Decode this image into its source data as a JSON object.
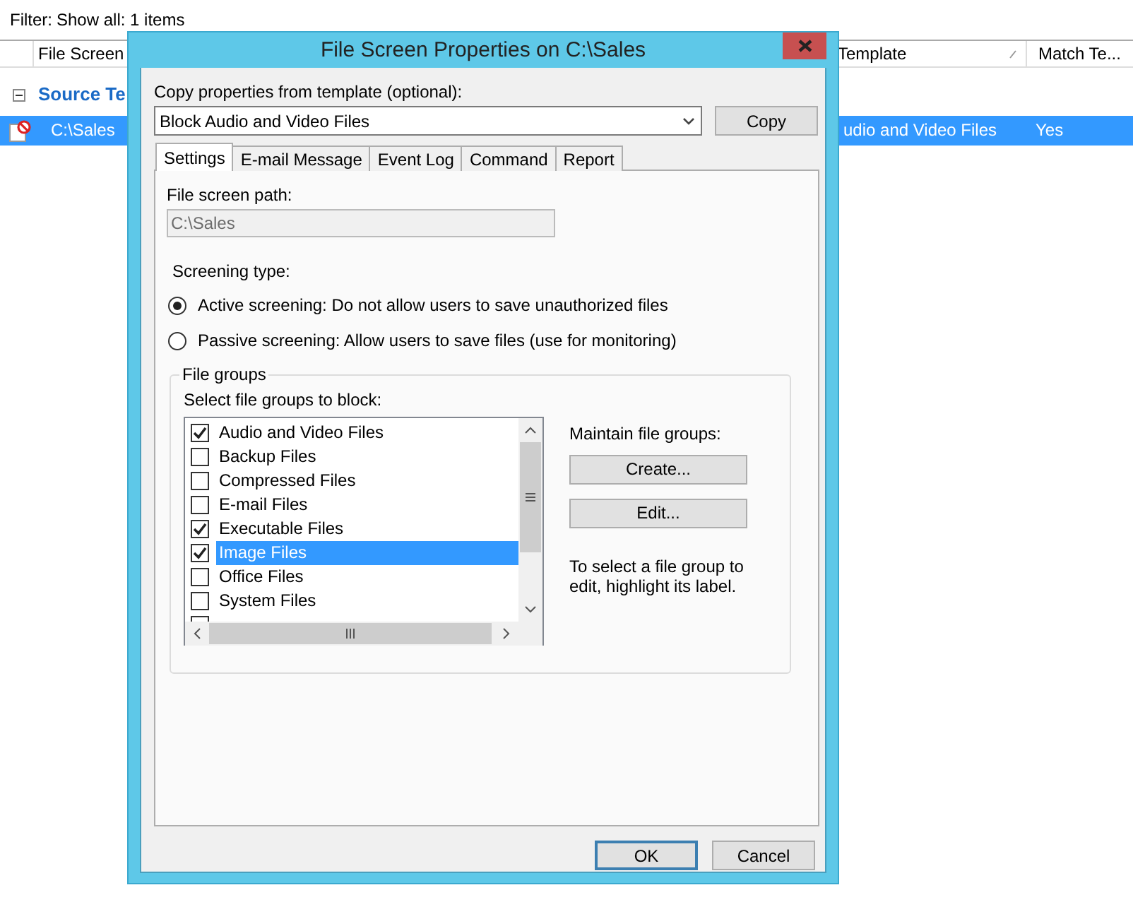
{
  "list_view": {
    "filter_link": "Filter:",
    "filter_text": "Show all: 1 items",
    "columns": [
      "File Screen",
      "Template",
      "Match Te..."
    ],
    "group": {
      "label": "Source Te",
      "expanded": true
    },
    "rows": [
      {
        "path": "C:\\Sales",
        "template": "udio and Video Files",
        "match": "Yes",
        "selected": true
      }
    ]
  },
  "dialog": {
    "title": "File Screen Properties on C:\\Sales",
    "copy_label": "Copy properties from template (optional):",
    "template_value": "Block Audio and Video Files",
    "copy_button": "Copy",
    "tabs": [
      {
        "label": "Settings",
        "selected": true
      },
      {
        "label": "E-mail Message",
        "selected": false
      },
      {
        "label": "Event Log",
        "selected": false
      },
      {
        "label": "Command",
        "selected": false
      },
      {
        "label": "Report",
        "selected": false
      }
    ],
    "path_label": "File screen path:",
    "path_value": "C:\\Sales",
    "screening_label": "Screening type:",
    "screening_options": [
      {
        "label": "Active screening: Do not allow users to save unauthorized files",
        "selected": true
      },
      {
        "label": "Passive screening: Allow users to save files (use for monitoring)",
        "selected": false
      }
    ],
    "group_title": "File groups",
    "list_label": "Select file groups to block:",
    "file_groups": [
      {
        "label": "Audio and Video Files",
        "checked": true,
        "selected": false
      },
      {
        "label": "Backup Files",
        "checked": false,
        "selected": false
      },
      {
        "label": "Compressed Files",
        "checked": false,
        "selected": false
      },
      {
        "label": "E-mail Files",
        "checked": false,
        "selected": false
      },
      {
        "label": "Executable Files",
        "checked": true,
        "selected": false
      },
      {
        "label": "Image Files",
        "checked": true,
        "selected": true
      },
      {
        "label": "Office Files",
        "checked": false,
        "selected": false
      },
      {
        "label": "System Files",
        "checked": false,
        "selected": false
      },
      {
        "checked": false
      }
    ],
    "maintain_label": "Maintain file groups:",
    "maintain_buttons": [
      "Create...",
      "Edit..."
    ],
    "hint": "To select a file group to edit, highlight its label.",
    "footer_buttons": [
      {
        "label": "OK",
        "default": true
      },
      {
        "label": "Cancel",
        "default": false
      }
    ]
  }
}
